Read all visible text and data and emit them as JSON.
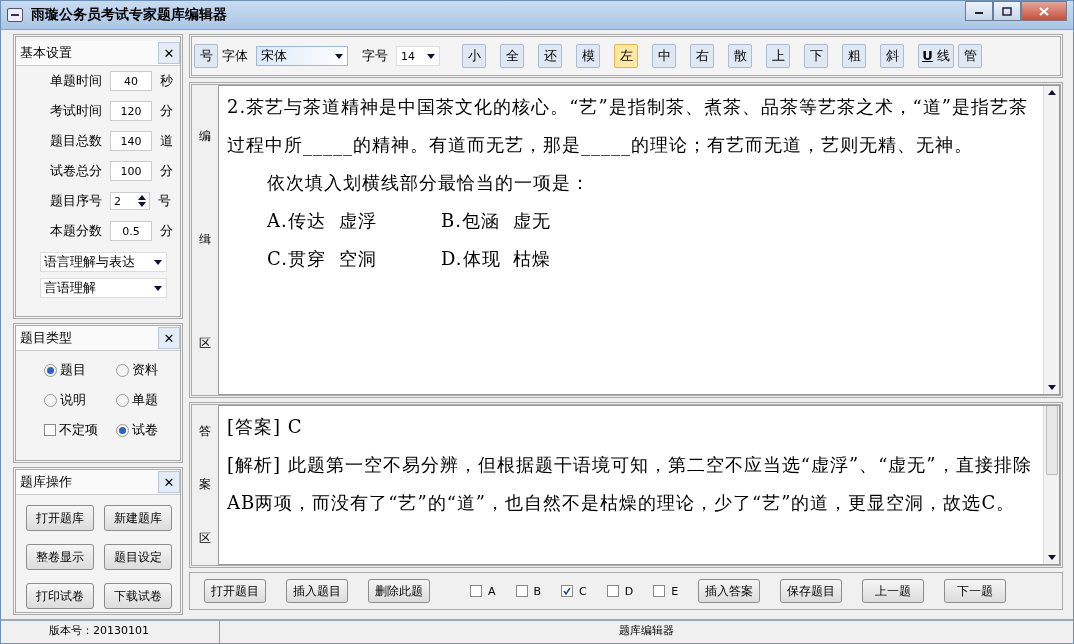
{
  "window": {
    "title": "雨璇公务员考试专家题库编辑器"
  },
  "basic_settings": {
    "title": "基本设置",
    "close": "✕",
    "fields": [
      {
        "label": "单题时间",
        "value": "40",
        "unit": "秒",
        "kind": "text"
      },
      {
        "label": "考试时间",
        "value": "120",
        "unit": "分",
        "kind": "text"
      },
      {
        "label": "题目总数",
        "value": "140",
        "unit": "道",
        "kind": "text"
      },
      {
        "label": "试卷总分",
        "value": "100",
        "unit": "分",
        "kind": "text"
      },
      {
        "label": "题目序号",
        "value": "2",
        "unit": "号",
        "kind": "spinner"
      },
      {
        "label": "本题分数",
        "value": "0.5",
        "unit": "分",
        "kind": "text"
      }
    ],
    "dropdowns": [
      "语言理解与表达",
      "言语理解"
    ]
  },
  "question_type": {
    "title": "题目类型",
    "close": "✕",
    "items": [
      {
        "label": "题目",
        "kind": "radio",
        "selected": true
      },
      {
        "label": "资料",
        "kind": "radio",
        "selected": false
      },
      {
        "label": "说明",
        "kind": "radio",
        "selected": false
      },
      {
        "label": "单题",
        "kind": "radio",
        "selected": false
      },
      {
        "label": "不定项",
        "kind": "checkbox",
        "checked": false
      },
      {
        "label": "试卷",
        "kind": "radio",
        "selected": true
      }
    ]
  },
  "bank_operations": {
    "title": "题库操作",
    "close": "✕",
    "buttons": [
      "打开题库",
      "新建题库",
      "整卷显示",
      "题目设定",
      "打印试卷",
      "下载试卷"
    ]
  },
  "toolbar": {
    "number_button": "号",
    "font_label": "字体",
    "font": "宋体",
    "size_label": "字号",
    "size": "14",
    "buttons": [
      {
        "label": "小",
        "selected": false
      },
      {
        "label": "全",
        "selected": false
      },
      {
        "label": "还",
        "selected": false
      },
      {
        "label": "模",
        "selected": false
      },
      {
        "label": "左",
        "selected": true
      },
      {
        "label": "中",
        "selected": false
      },
      {
        "label": "右",
        "selected": false
      },
      {
        "label": "散",
        "selected": false
      },
      {
        "label": "上",
        "selected": false
      },
      {
        "label": "下",
        "selected": false
      },
      {
        "label": "粗",
        "selected": false
      },
      {
        "label": "斜",
        "selected": false
      },
      {
        "label": "线",
        "prefix": "U",
        "selected": false
      },
      {
        "label": "管",
        "selected": false
      }
    ]
  },
  "editor": {
    "side_label": [
      "编",
      "缉",
      "区"
    ],
    "question": "2.茶艺与茶道精神是中国茶文化的核心。“艺”是指制茶、煮茶、品茶等艺茶之术，“道”是指艺茶过程中所_____的精神。有道而无艺，那是_____的理论；有艺而无道，艺则无精、无神。",
    "prompt": "依次填入划横线部分最恰当的一项是：",
    "options": [
      [
        "A.传达",
        "虚浮",
        "B.包涵",
        "虚无"
      ],
      [
        "C.贯穿",
        "空洞",
        "D.体现",
        "枯燥"
      ]
    ]
  },
  "answer": {
    "side_label": [
      "答",
      "案",
      "区"
    ],
    "paragraphs": [
      "[答案] C",
      "[解析] 此题第一空不易分辨，但根据题干语境可知，第二空不应当选“虚浮”、“虚无”，直接排除AB两项，而没有了“艺”的“道”，也自然不是枯燥的理论，少了“艺”的道，更显空洞，故选C。"
    ]
  },
  "bottom_bar": {
    "left_buttons": [
      "打开题目",
      "插入题目",
      "删除此题"
    ],
    "choices": [
      {
        "label": "A",
        "checked": false
      },
      {
        "label": "B",
        "checked": false
      },
      {
        "label": "C",
        "checked": true
      },
      {
        "label": "D",
        "checked": false
      },
      {
        "label": "E",
        "checked": false
      }
    ],
    "right_buttons": [
      "插入答案",
      "保存题目",
      "上一题",
      "下一题"
    ]
  },
  "status_bar": {
    "version": "版本号：20130101",
    "center": "题库编辑器"
  }
}
